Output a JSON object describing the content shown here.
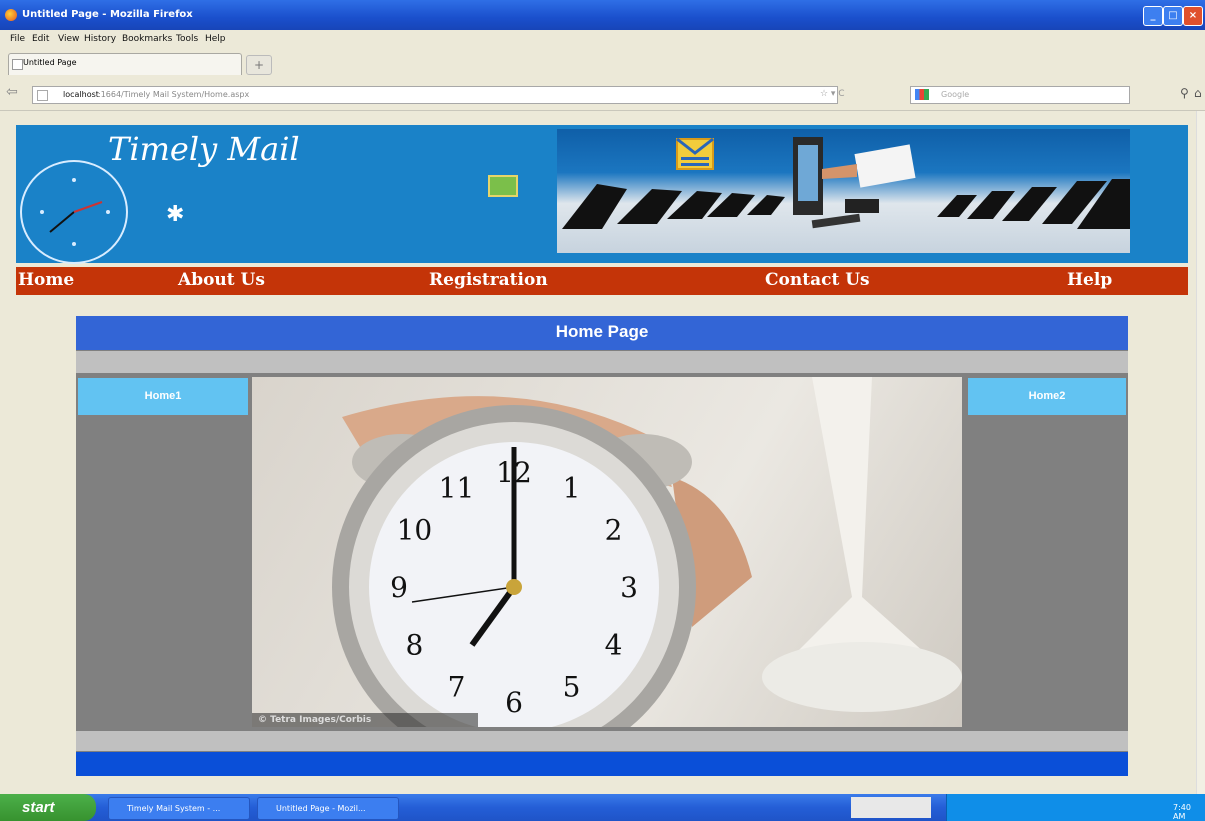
{
  "window": {
    "title": "Untitled Page - Mozilla Firefox",
    "min": "_",
    "max": "□",
    "close": "×"
  },
  "menus": [
    "File",
    "Edit",
    "View",
    "History",
    "Bookmarks",
    "Tools",
    "Help"
  ],
  "tab": {
    "label": "Untitled Page",
    "new_tab": "+"
  },
  "address": {
    "host": "localhost",
    "path": ":1664/Timely Mail System/Home.aspx",
    "search_placeholder": "Google"
  },
  "site": {
    "title": "Timely Mail",
    "nav": [
      "Home",
      "About Us",
      "Registration",
      "Contact Us",
      "Help"
    ],
    "content_title": "Home Page",
    "left_panel": "Home1",
    "right_panel": "Home2",
    "photo_credit": "© Tetra Images/Corbis",
    "clock_numbers": [
      "11",
      "12",
      "1",
      "10",
      "2",
      "9",
      "3",
      "8",
      "4",
      "7",
      "6",
      "5"
    ]
  },
  "taskbar": {
    "start": "start",
    "tasks": [
      "Timely Mail System - ...",
      "Untitled Page - Mozil..."
    ],
    "time": "7:40 AM"
  }
}
